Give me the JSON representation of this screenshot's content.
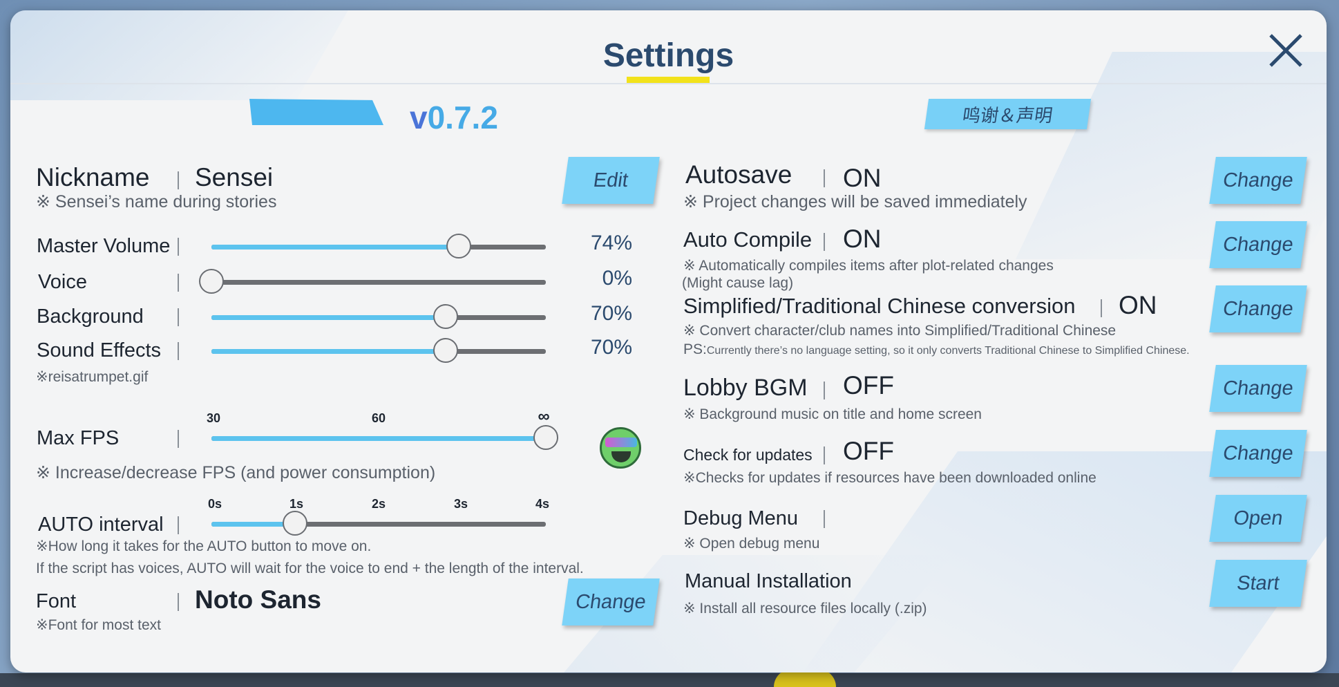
{
  "window": {
    "title": "Settings"
  },
  "header": {
    "version_prefix": "v",
    "version": "0.7.2",
    "thanks_label": "鸣谢＆声明"
  },
  "left": {
    "nickname": {
      "label": "Nickname",
      "value": "Sensei",
      "note": "※ Sensei’s name during stories",
      "button": "Edit"
    },
    "volumes": [
      {
        "label": "Master Volume",
        "value_text": "74%",
        "level": 0.74
      },
      {
        "label": "Voice",
        "value_text": "0%",
        "level": 0.0
      },
      {
        "label": "Background",
        "value_text": "70%",
        "level": 0.7
      },
      {
        "label": "Sound Effects",
        "value_text": "70%",
        "level": 0.7
      }
    ],
    "volume_note": "※reisatrumpet.gif",
    "max_fps": {
      "label": "Max FPS",
      "ticks": [
        "30",
        "60",
        "∞"
      ],
      "level": 1.0,
      "note": "※ Increase/decrease FPS (and power consumption)",
      "emoji_icon": "sunglasses-emoji-icon"
    },
    "auto_interval": {
      "label": "AUTO interval",
      "ticks": [
        "0s",
        "1s",
        "2s",
        "3s",
        "4s"
      ],
      "level": 0.25,
      "note1": "※How long it takes for the AUTO button to move on.",
      "note2": "If the script has voices, AUTO will wait for the voice to end + the length of the interval."
    },
    "font": {
      "label": "Font",
      "value": "Noto Sans",
      "note": "※Font for most text",
      "button": "Change"
    }
  },
  "right": {
    "autosave": {
      "label": "Autosave",
      "value": "ON",
      "note": "※ Project changes will be saved immediately",
      "button": "Change"
    },
    "auto_compile": {
      "label": "Auto Compile",
      "value": "ON",
      "note1": "※ Automatically compiles items after plot-related changes",
      "note2": "(Might cause lag)",
      "button": "Change"
    },
    "chinese_conv": {
      "label": "Simplified/Traditional Chinese conversion",
      "value": "ON",
      "note1": "※ Convert character/club names into Simplified/Traditional Chinese",
      "note2_prefix": "PS:",
      "note2": "Currently there’s no language setting, so it only converts Traditional Chinese to Simplified Chinese.",
      "button": "Change"
    },
    "lobby_bgm": {
      "label": "Lobby BGM",
      "value": "OFF",
      "note": "※ Background music on title and home screen",
      "button": "Change"
    },
    "check_updates": {
      "label": "Check for updates",
      "value": "OFF",
      "note": "※Checks for updates if resources have been downloaded online",
      "button": "Change"
    },
    "debug_menu": {
      "label": "Debug Menu",
      "note": "※ Open debug menu",
      "button": "Open"
    },
    "manual_install": {
      "label": "Manual Installation",
      "note": "※ Install all resource files locally (.zip)",
      "button": "Start"
    }
  },
  "colors": {
    "accent": "#7dd3f8",
    "title": "#2b4a6e",
    "slider_fill": "#5cc3ee",
    "underline": "#f2e21b"
  }
}
